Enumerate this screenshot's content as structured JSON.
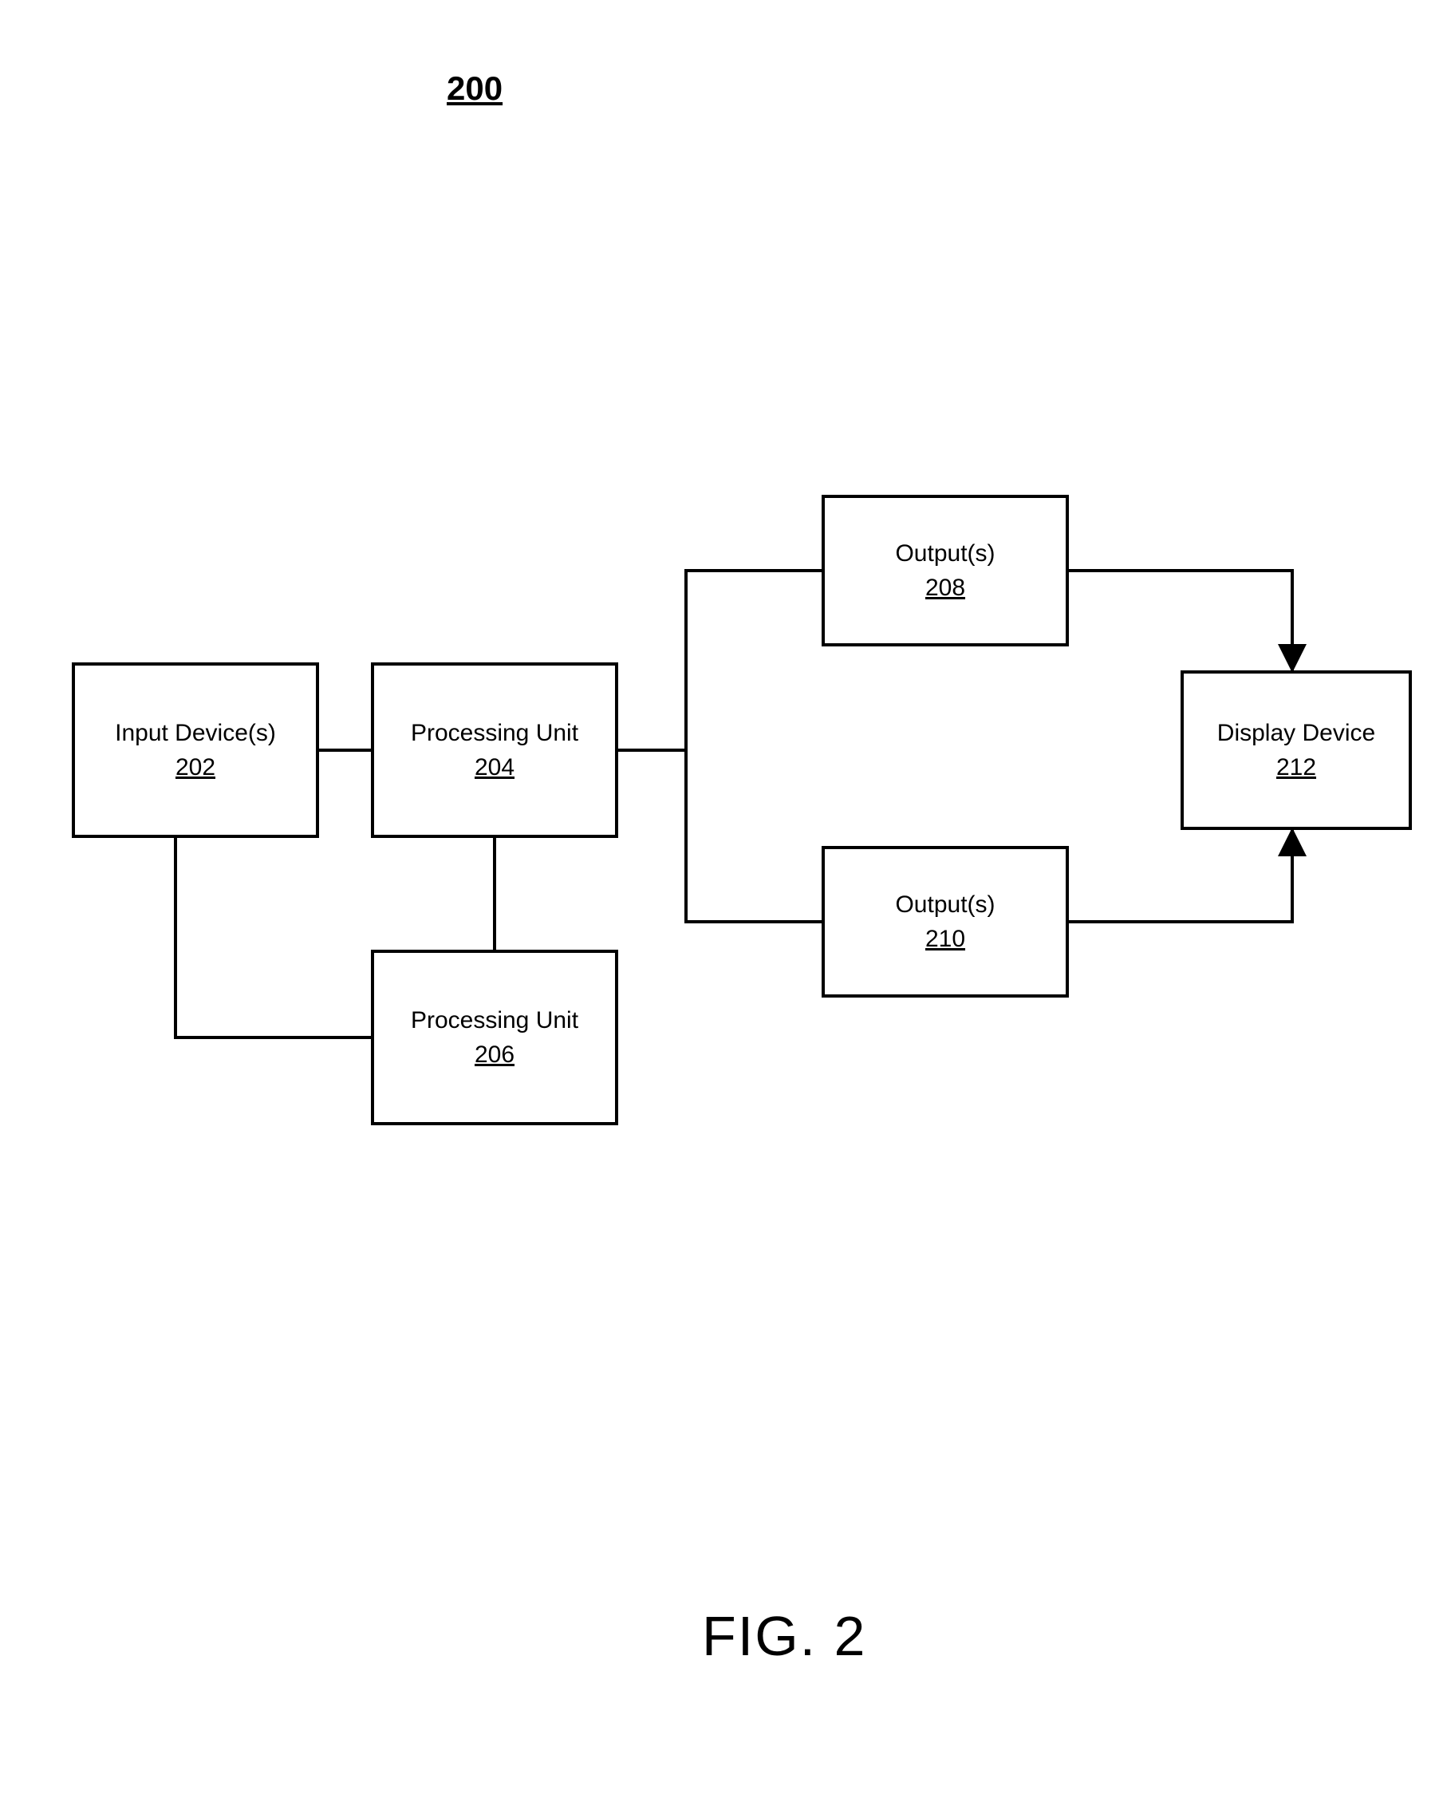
{
  "figure_number": "200",
  "figure_caption": "FIG. 2",
  "boxes": {
    "input": {
      "label": "Input Device(s)",
      "ref": "202"
    },
    "proc1": {
      "label": "Processing Unit",
      "ref": "204"
    },
    "proc2": {
      "label": "Processing Unit",
      "ref": "206"
    },
    "out1": {
      "label": "Output(s)",
      "ref": "208"
    },
    "out2": {
      "label": "Output(s)",
      "ref": "210"
    },
    "display": {
      "label": "Display Device",
      "ref": "212"
    }
  }
}
